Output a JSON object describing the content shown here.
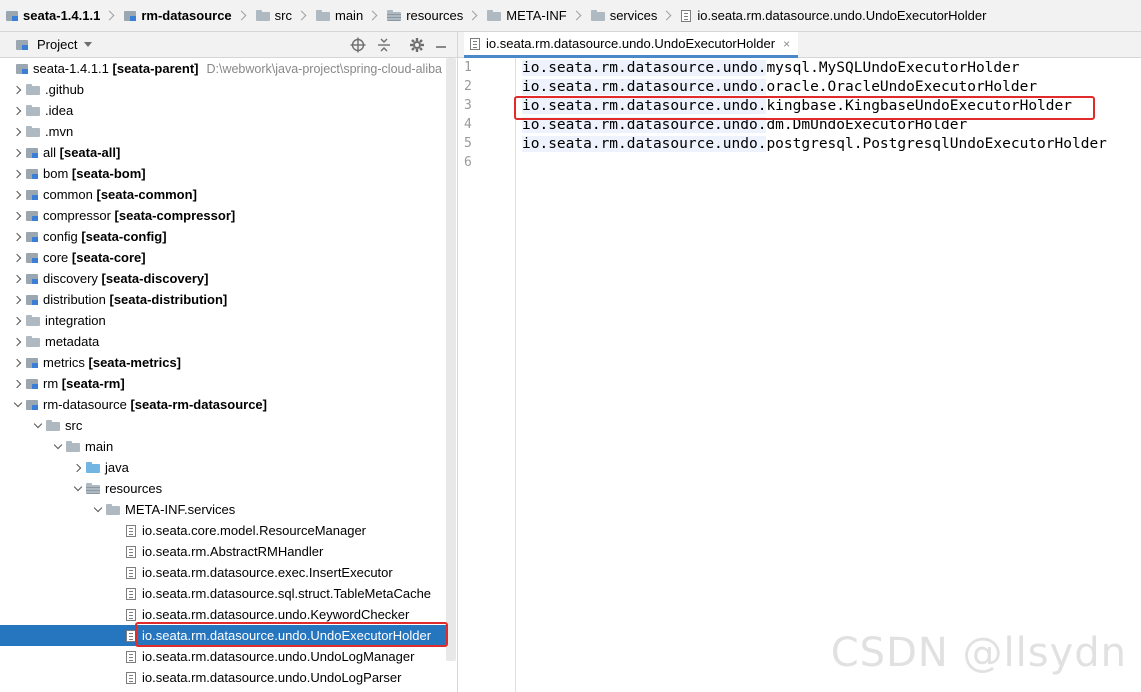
{
  "breadcrumb": [
    {
      "label": "seata-1.4.1.1",
      "icon": "module-icon",
      "bold": true
    },
    {
      "label": "rm-datasource",
      "icon": "module-icon",
      "bold": true
    },
    {
      "label": "src",
      "icon": "folder-icon",
      "bold": false
    },
    {
      "label": "main",
      "icon": "folder-icon",
      "bold": false
    },
    {
      "label": "resources",
      "icon": "resources-folder-icon",
      "bold": false
    },
    {
      "label": "META-INF",
      "icon": "folder-icon",
      "bold": false
    },
    {
      "label": "services",
      "icon": "folder-icon",
      "bold": false
    },
    {
      "label": "io.seata.rm.datasource.undo.UndoExecutorHolder",
      "icon": "file-icon",
      "bold": false
    }
  ],
  "project_panel": {
    "title": "Project",
    "tools": [
      "locate-icon",
      "collapse-icon",
      "gear-icon",
      "minimize-icon"
    ]
  },
  "tree": [
    {
      "depth": 0,
      "arrow": "none",
      "icon": "module",
      "name": "seata-1.4.1.1",
      "module": "[seata-parent]",
      "path": "D:\\webwork\\java-project\\spring-cloud-aliba"
    },
    {
      "depth": 1,
      "arrow": "r",
      "icon": "folder",
      "name": ".github",
      "module": ""
    },
    {
      "depth": 1,
      "arrow": "r",
      "icon": "folder",
      "name": ".idea",
      "module": ""
    },
    {
      "depth": 1,
      "arrow": "r",
      "icon": "folder",
      "name": ".mvn",
      "module": ""
    },
    {
      "depth": 1,
      "arrow": "r",
      "icon": "module",
      "name": "all",
      "module": "[seata-all]"
    },
    {
      "depth": 1,
      "arrow": "r",
      "icon": "module",
      "name": "bom",
      "module": "[seata-bom]"
    },
    {
      "depth": 1,
      "arrow": "r",
      "icon": "module",
      "name": "common",
      "module": "[seata-common]"
    },
    {
      "depth": 1,
      "arrow": "r",
      "icon": "module",
      "name": "compressor",
      "module": "[seata-compressor]"
    },
    {
      "depth": 1,
      "arrow": "r",
      "icon": "module",
      "name": "config",
      "module": "[seata-config]"
    },
    {
      "depth": 1,
      "arrow": "r",
      "icon": "module",
      "name": "core",
      "module": "[seata-core]"
    },
    {
      "depth": 1,
      "arrow": "r",
      "icon": "module",
      "name": "discovery",
      "module": "[seata-discovery]"
    },
    {
      "depth": 1,
      "arrow": "r",
      "icon": "module",
      "name": "distribution",
      "module": "[seata-distribution]"
    },
    {
      "depth": 1,
      "arrow": "r",
      "icon": "folder",
      "name": "integration",
      "module": ""
    },
    {
      "depth": 1,
      "arrow": "r",
      "icon": "folder",
      "name": "metadata",
      "module": ""
    },
    {
      "depth": 1,
      "arrow": "r",
      "icon": "module",
      "name": "metrics",
      "module": "[seata-metrics]"
    },
    {
      "depth": 1,
      "arrow": "r",
      "icon": "module",
      "name": "rm",
      "module": "[seata-rm]"
    },
    {
      "depth": 1,
      "arrow": "d",
      "icon": "module",
      "name": "rm-datasource",
      "module": "[seata-rm-datasource]"
    },
    {
      "depth": 2,
      "arrow": "d",
      "icon": "folder",
      "name": "src",
      "module": ""
    },
    {
      "depth": 3,
      "arrow": "d",
      "icon": "folder",
      "name": "main",
      "module": ""
    },
    {
      "depth": 4,
      "arrow": "r",
      "icon": "folder-blue",
      "name": "java",
      "module": ""
    },
    {
      "depth": 4,
      "arrow": "d",
      "icon": "folder-res",
      "name": "resources",
      "module": ""
    },
    {
      "depth": 5,
      "arrow": "d",
      "icon": "folder",
      "name": "META-INF.services",
      "module": ""
    },
    {
      "depth": 6,
      "arrow": "none",
      "icon": "file",
      "name": "io.seata.core.model.ResourceManager",
      "module": ""
    },
    {
      "depth": 6,
      "arrow": "none",
      "icon": "file",
      "name": "io.seata.rm.AbstractRMHandler",
      "module": ""
    },
    {
      "depth": 6,
      "arrow": "none",
      "icon": "file",
      "name": "io.seata.rm.datasource.exec.InsertExecutor",
      "module": ""
    },
    {
      "depth": 6,
      "arrow": "none",
      "icon": "file",
      "name": "io.seata.rm.datasource.sql.struct.TableMetaCache",
      "module": ""
    },
    {
      "depth": 6,
      "arrow": "none",
      "icon": "file",
      "name": "io.seata.rm.datasource.undo.KeywordChecker",
      "module": ""
    },
    {
      "depth": 6,
      "arrow": "none",
      "icon": "file",
      "name": "io.seata.rm.datasource.undo.UndoExecutorHolder",
      "module": "",
      "selected": true
    },
    {
      "depth": 6,
      "arrow": "none",
      "icon": "file",
      "name": "io.seata.rm.datasource.undo.UndoLogManager",
      "module": ""
    },
    {
      "depth": 6,
      "arrow": "none",
      "icon": "file",
      "name": "io.seata.rm.datasource.undo.UndoLogParser",
      "module": ""
    }
  ],
  "editor": {
    "tab_label": "io.seata.rm.datasource.undo.UndoExecutorHolder",
    "close_glyph": "×",
    "line_numbers": [
      "1",
      "2",
      "3",
      "4",
      "5",
      "6"
    ],
    "lines": [
      {
        "common": "io.seata.rm.datasource.undo.",
        "rest": "mysql.MySQLUndoExecutorHolder"
      },
      {
        "common": "io.seata.rm.datasource.undo.",
        "rest": "oracle.OracleUndoExecutorHolder"
      },
      {
        "common": "io.seata.rm.datasource.undo.",
        "rest": "kingbase.KingbaseUndoExecutorHolder"
      },
      {
        "common": "io.seata.rm.datasource.undo.",
        "rest": "dm.DmUndoExecutorHolder"
      },
      {
        "common": "io.seata.rm.datasource.undo.",
        "rest": "postgresql.PostgresqlUndoExecutorHolder"
      },
      {
        "common": "",
        "rest": ""
      }
    ]
  },
  "watermark": "CSDN @llsydn",
  "colors": {
    "selection": "#2675bf",
    "highlight_box": "#e12a2a",
    "common_prefix_bg": "#edf2fc"
  }
}
